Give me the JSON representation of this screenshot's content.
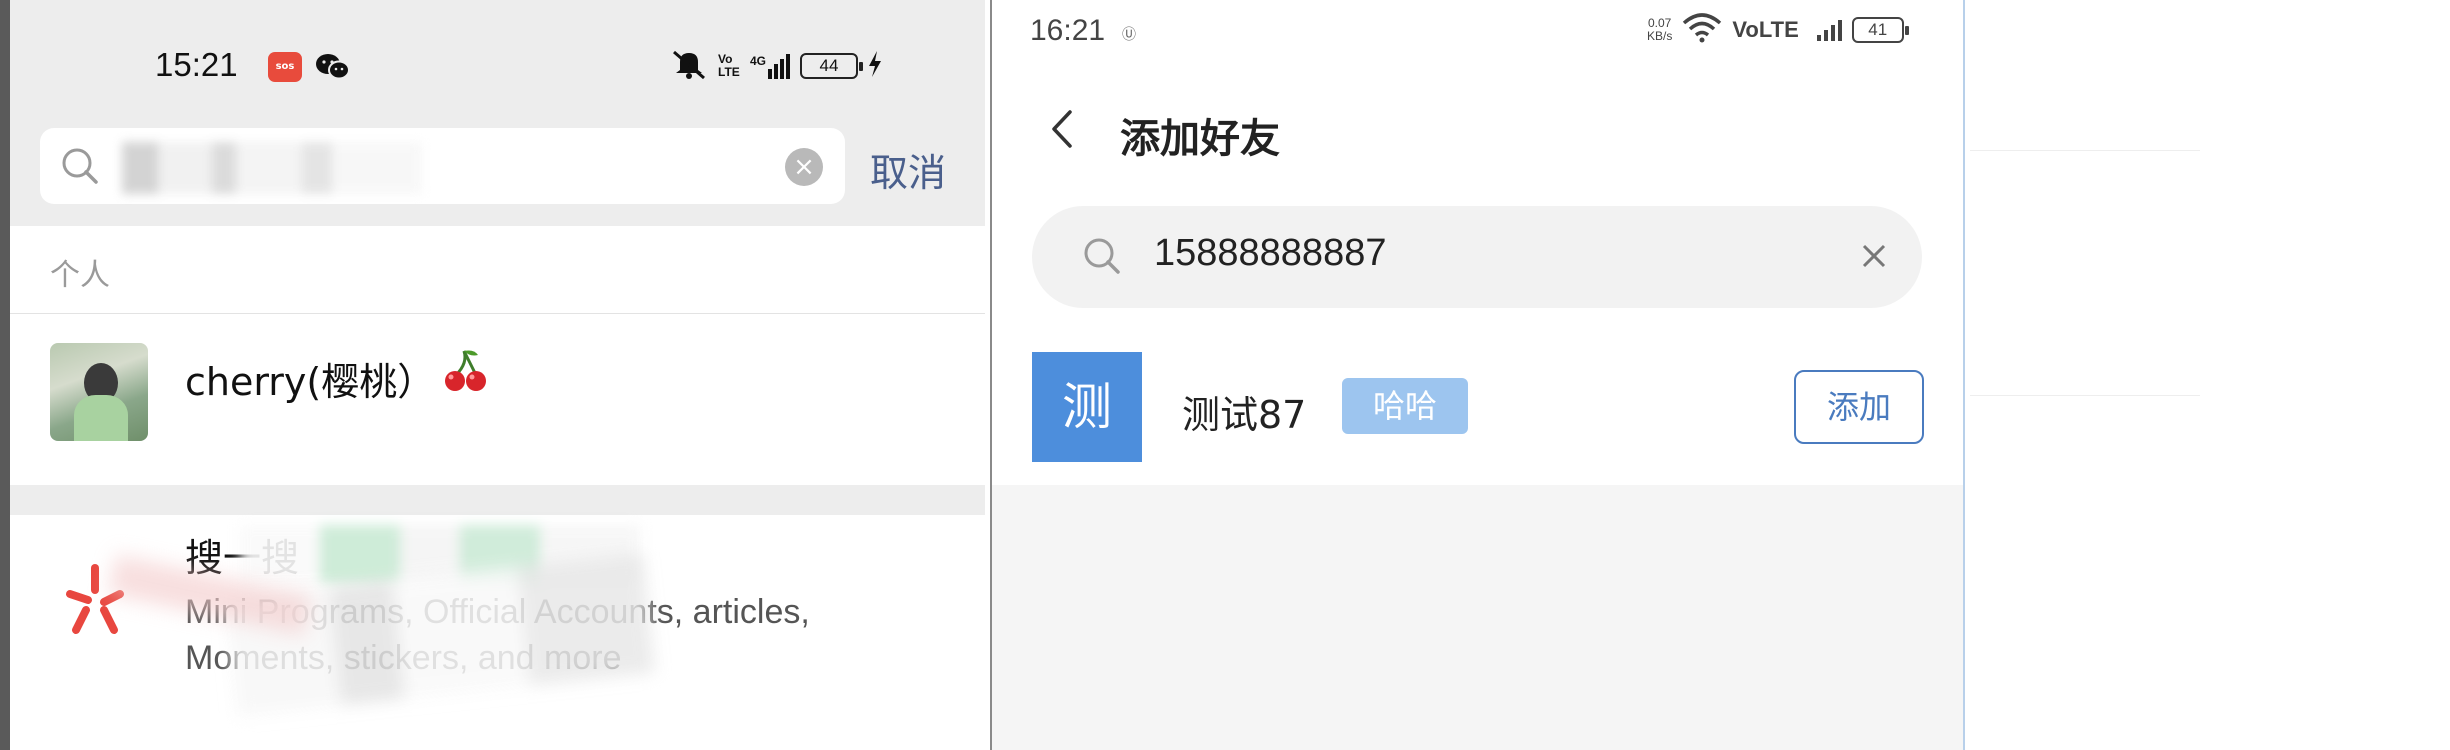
{
  "left_phone": {
    "status_bar": {
      "time": "15:21",
      "sos_badge": "sos",
      "signal_text": "4G",
      "volte_text": "Vo LTE",
      "battery": "44"
    },
    "search": {
      "value": "",
      "cancel_label": "取消"
    },
    "section_label": "个人",
    "contact": {
      "name": "cherry(樱桃）",
      "emoji_icon": "cherry-icon"
    },
    "search_one": {
      "title": "搜一搜",
      "description": "Mini Programs, Official Accounts, articles, Moments, stickers, and more"
    }
  },
  "right_phone": {
    "status_bar": {
      "time": "16:21",
      "usb_text": "Ⓤ",
      "net_speed_value": "0.07",
      "net_speed_unit": "KB/s",
      "volte_text": "VoLTE",
      "battery": "41"
    },
    "header": {
      "title": "添加好友"
    },
    "search": {
      "value": "15888888887"
    },
    "result": {
      "avatar_char": "测",
      "name": "测试87",
      "tag": "哈哈",
      "add_label": "添加"
    }
  },
  "colors": {
    "left_bg": "#ededed",
    "cancel_text": "#4a5f8c",
    "avatar_blue": "#4d8edc",
    "tag_blue": "#9dc5ef",
    "add_border": "#4a7bbf"
  }
}
